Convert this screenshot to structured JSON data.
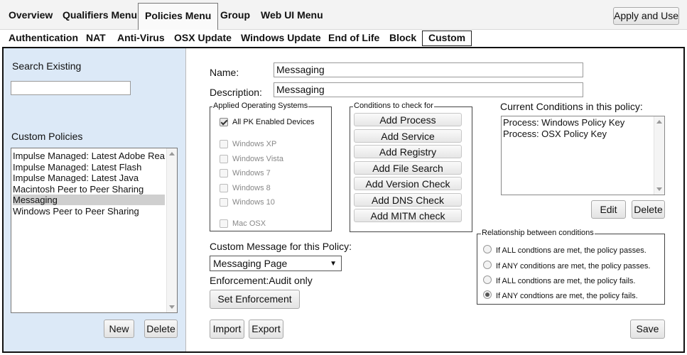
{
  "top_menu": {
    "overview": "Overview",
    "qualifiers": "Qualifiers Menu",
    "policies": "Policies Menu",
    "group": "Group",
    "web_ui": "Web UI Menu",
    "apply_button": "Apply and Use"
  },
  "sub_menu": {
    "authentication": "Authentication",
    "nat": "NAT",
    "antivirus": "Anti-Virus",
    "osx_update": "OSX Update",
    "windows_update": "Windows Update",
    "end_of_life": "End of Life",
    "block": "Block",
    "custom": "Custom"
  },
  "left_pane": {
    "search_label": "Search Existing",
    "search_value": "",
    "policies_label": "Custom Policies",
    "policies": [
      "Impulse Managed: Latest Adobe Rea",
      "Impulse Managed: Latest Flash",
      "Impulse Managed: Latest Java",
      "Macintosh Peer to Peer Sharing",
      "Messaging",
      "Windows Peer to Peer Sharing"
    ],
    "selected_policy": "Messaging",
    "new_button": "New",
    "delete_button": "Delete"
  },
  "form": {
    "name_label": "Name:",
    "name_value": "Messaging",
    "description_label": "Description:",
    "description_value": "Messaging"
  },
  "os_group": {
    "legend": "Applied Operating Systems",
    "all_enabled": "All PK Enabled Devices",
    "all_checked": true,
    "systems": [
      "Windows XP",
      "Windows Vista",
      "Windows 7",
      "Windows 8",
      "Windows 10",
      "Mac OSX"
    ]
  },
  "conditions_group": {
    "legend": "Conditions to check for",
    "buttons": [
      "Add Process",
      "Add Service",
      "Add Registry",
      "Add File Search",
      "Add Version Check",
      "Add DNS Check",
      "Add MITM check"
    ]
  },
  "current_conditions": {
    "label": "Current Conditions in this policy:",
    "items": [
      "Process: Windows Policy Key",
      "Process: OSX Policy Key"
    ],
    "edit_button": "Edit",
    "delete_button": "Delete"
  },
  "message": {
    "label": "Custom Message for this Policy:",
    "selected": "Messaging Page",
    "enforcement_text": "Enforcement:Audit only",
    "set_enforcement_button": "Set Enforcement",
    "import_button": "Import",
    "export_button": "Export"
  },
  "relationship": {
    "legend": "Relationship between conditions",
    "options": [
      "If ALL condtions are met, the policy passes.",
      "If ANY conditions are met, the policy passes.",
      "If ALL condtions are met, the policy fails.",
      "If ANY condtions are met, the policy fails."
    ],
    "selected_index": 3
  },
  "save_button": "Save"
}
